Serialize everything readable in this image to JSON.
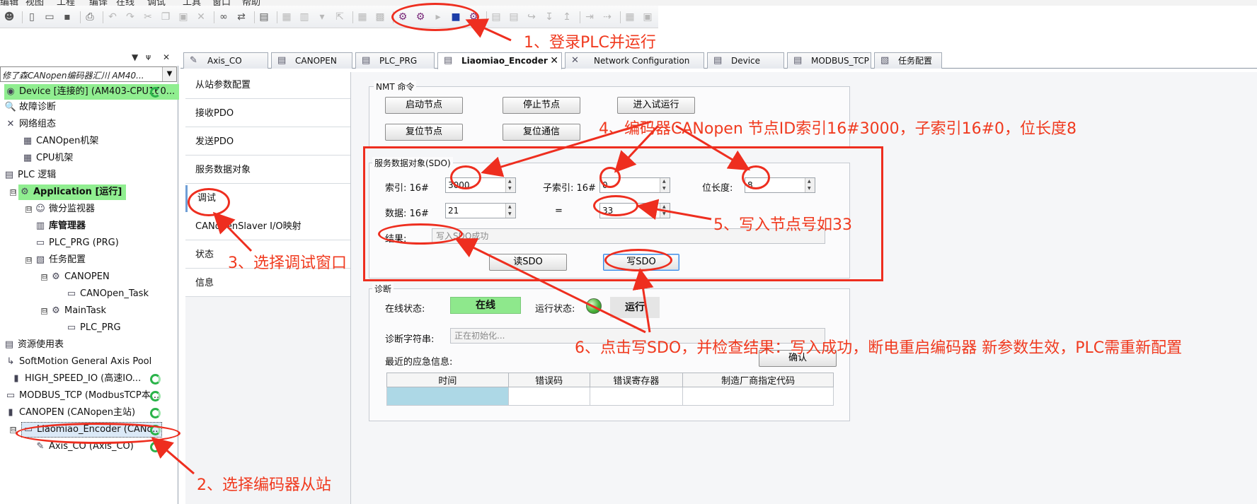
{
  "menu": [
    "编辑",
    "视图",
    "工程",
    "编译",
    "在线",
    "调试",
    "工具",
    "窗口",
    "帮助"
  ],
  "toolbar": {
    "icons": [
      "user-icon",
      "new-file-icon",
      "open-folder-icon",
      "save-icon",
      "print-icon",
      "undo-icon",
      "redo-icon",
      "cut-icon",
      "copy-icon",
      "paste-icon",
      "delete-icon",
      "binoculars-icon",
      "find-replace-icon",
      "select-all-icon",
      "grid-icon",
      "table-icon",
      "dropdown-icon",
      "export-icon",
      "build-icon",
      "clean-icon",
      "login-icon",
      "logout-icon",
      "run-icon",
      "stop-icon",
      "reset-icon",
      "breakpoint-icon",
      "breakpoint2-icon",
      "step-over-icon",
      "step-into-icon",
      "step-out-icon",
      "step-icon",
      "run-to-cursor-icon",
      "write-values-icon",
      "monitor-icon"
    ]
  },
  "tree": {
    "header_arrow": "▼",
    "header_pin": "ᴪ",
    "header_close": "✕",
    "combo_text": "修了森CANopen编码器汇川 AM40...",
    "combo_arrow": "▼",
    "items": [
      {
        "label": "Device [连接的] (AM403-CPU160...",
        "icon": "◉"
      },
      {
        "label": "故障诊断",
        "icon": "🔍"
      },
      {
        "label": "网络组态",
        "icon": "✕"
      },
      {
        "label": "CANOpen机架",
        "icon": "▦"
      },
      {
        "label": "CPU机架",
        "icon": "▦"
      },
      {
        "label": "PLC 逻辑",
        "icon": "▤"
      },
      {
        "label": "Application [运行]",
        "icon": "⚙"
      },
      {
        "label": "微分监视器",
        "icon": "☺"
      },
      {
        "label": "库管理器",
        "icon": "▥"
      },
      {
        "label": "PLC_PRG (PRG)",
        "icon": "▭"
      },
      {
        "label": "任务配置",
        "icon": "▧"
      },
      {
        "label": "CANOPEN",
        "icon": "⚙"
      },
      {
        "label": "CANOpen_Task",
        "icon": "▭"
      },
      {
        "label": "MainTask",
        "icon": "⚙"
      },
      {
        "label": "PLC_PRG",
        "icon": "▭"
      },
      {
        "label": "资源使用表",
        "icon": "▤"
      },
      {
        "label": "SoftMotion General Axis Pool",
        "icon": "↳"
      },
      {
        "label": "HIGH_SPEED_IO (高速IO...",
        "icon": "▮"
      },
      {
        "label": "MODBUS_TCP (ModbusTCP本...",
        "icon": "▭"
      },
      {
        "label": "CANOPEN (CANopen主站)",
        "icon": "▮"
      },
      {
        "label": "Liaomiao_Encoder (CANo...",
        "icon": "▭"
      },
      {
        "label": "Axis_CO (Axis_CO)",
        "icon": "✎"
      }
    ],
    "expanders": [
      "⊟",
      "⊟",
      "⊟",
      "⊟",
      "⊟",
      "⊟"
    ]
  },
  "tabs": [
    {
      "label": "Axis_CO",
      "icon": "✎"
    },
    {
      "label": "CANOPEN",
      "icon": "▤"
    },
    {
      "label": "PLC_PRG",
      "icon": "▤"
    },
    {
      "label": "Liaomiao_Encoder",
      "icon": "▤",
      "close": "✕"
    },
    {
      "label": "Network Configuration",
      "icon": "✕"
    },
    {
      "label": "Device",
      "icon": "▤"
    },
    {
      "label": "MODBUS_TCP",
      "icon": "▤"
    },
    {
      "label": "任务配置",
      "icon": "▧"
    }
  ],
  "nav": [
    "从站参数配置",
    "接收PDO",
    "发送PDO",
    "服务数据对象",
    "调试",
    "CANopenSlaver I/O映射",
    "状态",
    "信息"
  ],
  "nmt": {
    "title": "NMT 命令",
    "buttons": [
      "启动节点",
      "停止节点",
      "进入试运行",
      "复位节点",
      "复位通信"
    ]
  },
  "sdo": {
    "title": "服务数据对象(SDO)",
    "index_label": "索引:  16#",
    "index_value": "3000",
    "subindex_label": "子索引: 16#",
    "subindex_value": "0",
    "bitlen_label": "位长度:",
    "bitlen_value": "8",
    "data_label": "数据:  16#",
    "data_value": "21",
    "equals": "=",
    "data_dec_value": "33",
    "result_label": "结果:",
    "result_value": "写入SDO成功",
    "read_button": "读SDO",
    "write_button": "写SDO"
  },
  "diag": {
    "title": "诊断",
    "online_label": "在线状态:",
    "online_value": "在线",
    "run_label": "运行状态:",
    "run_value": "运行",
    "diag_label": "诊断字符串:",
    "diag_value": "正在初始化...",
    "emcy_label": "最近的应急信息:",
    "confirm_button": "确认",
    "columns": [
      "时间",
      "错误码",
      "错误寄存器",
      "制造厂商指定代码"
    ]
  },
  "annotations": {
    "a1": "1、登录PLC并运行",
    "a2": "2、选择编码器从站",
    "a3": "3、选择调试窗口",
    "a4": "4、编码器CANopen 节点ID索引16#3000，子索引16#0，位长度8",
    "a5": "5、写入节点号如33",
    "a6": "6、点击写SDO，并检查结果：写入成功，断电重启编码器 新参数生效，PLC需重新配置"
  },
  "colors": {
    "annotation": "#ee2e1f",
    "online": "#8ee88c",
    "highlight": "#90ee90",
    "selected_cell": "#add8e6"
  }
}
